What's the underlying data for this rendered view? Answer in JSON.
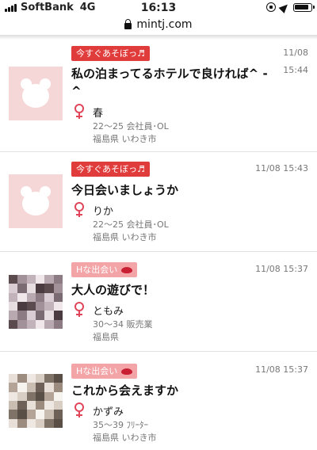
{
  "status_bar": {
    "carrier": "SoftBank",
    "network": "4G",
    "time": "16:13"
  },
  "url_bar": {
    "domain": "mintj.com"
  },
  "posts": [
    {
      "category": "今すぐあそぼっ♬",
      "category_style": "red",
      "date": "11/08",
      "time": "15:44",
      "title": "私の泊まってるホテルで良ければ^ - ^",
      "name": "春",
      "age_job": "22～25 会社員･OL",
      "location": "福島県 いわき市",
      "thumbnail": "placeholder"
    },
    {
      "category": "今すぐあそぼっ♬",
      "category_style": "red",
      "date": "11/08 15:43",
      "title": "今日会いましょうか",
      "name": "りか",
      "age_job": "22～25 会社員･OL",
      "location": "福島県 いわき市",
      "thumbnail": "placeholder"
    },
    {
      "category": "Hな出会い",
      "category_style": "pink",
      "date": "11/08 15:37",
      "title": "大人の遊びで！",
      "name": "ともみ",
      "age_job": "30～34 販売業",
      "location": "福島県",
      "thumbnail": "photo"
    },
    {
      "category": "Hな出会い",
      "category_style": "pink",
      "date": "11/08 15:37",
      "title": "これから会えますか",
      "name": "かずみ",
      "age_job": "35～39 ﾌﾘｰﾀｰ",
      "location": "福島県 いわき市",
      "thumbnail": "photo"
    }
  ]
}
